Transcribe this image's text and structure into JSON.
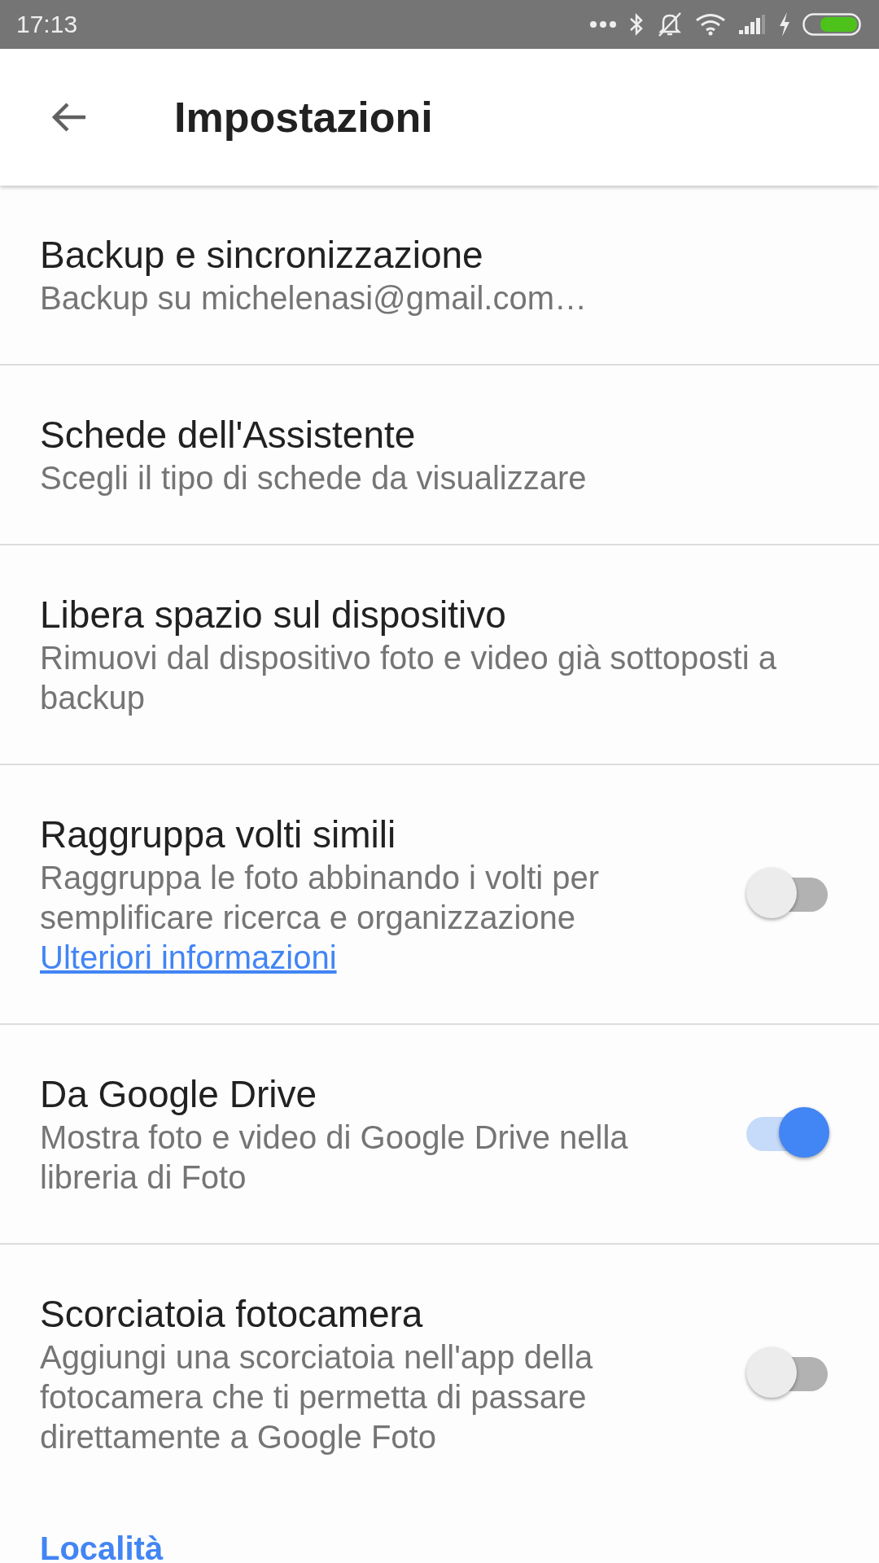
{
  "status_bar": {
    "time": "17:13"
  },
  "app_bar": {
    "title": "Impostazioni"
  },
  "settings": [
    {
      "kind": "plain",
      "title": "Backup e sincronizzazione",
      "subtitle": "Backup su michelenasi@gmail.com…"
    },
    {
      "kind": "plain",
      "title": "Schede dell'Assistente",
      "subtitle": "Scegli il tipo di schede da visualizzare"
    },
    {
      "kind": "plain",
      "title": "Libera spazio sul dispositivo",
      "subtitle": "Rimuovi dal dispositivo foto e video già sottoposti a backup"
    },
    {
      "kind": "toggle",
      "title": "Raggruppa volti simili",
      "subtitle": "Raggruppa le foto abbinando i volti per semplificare ricerca e organizzazione",
      "link": "Ulteriori informazioni",
      "on": false
    },
    {
      "kind": "toggle",
      "title": "Da Google Drive",
      "subtitle": "Mostra foto e video di Google Drive nella libreria di Foto",
      "on": true
    },
    {
      "kind": "toggle",
      "title": "Scorciatoia fotocamera",
      "subtitle": "Aggiungi una scorciatoia nell'app della fotocamera che ti permetta di passare direttamente a Google Foto",
      "on": false
    }
  ],
  "section_header": "Località"
}
